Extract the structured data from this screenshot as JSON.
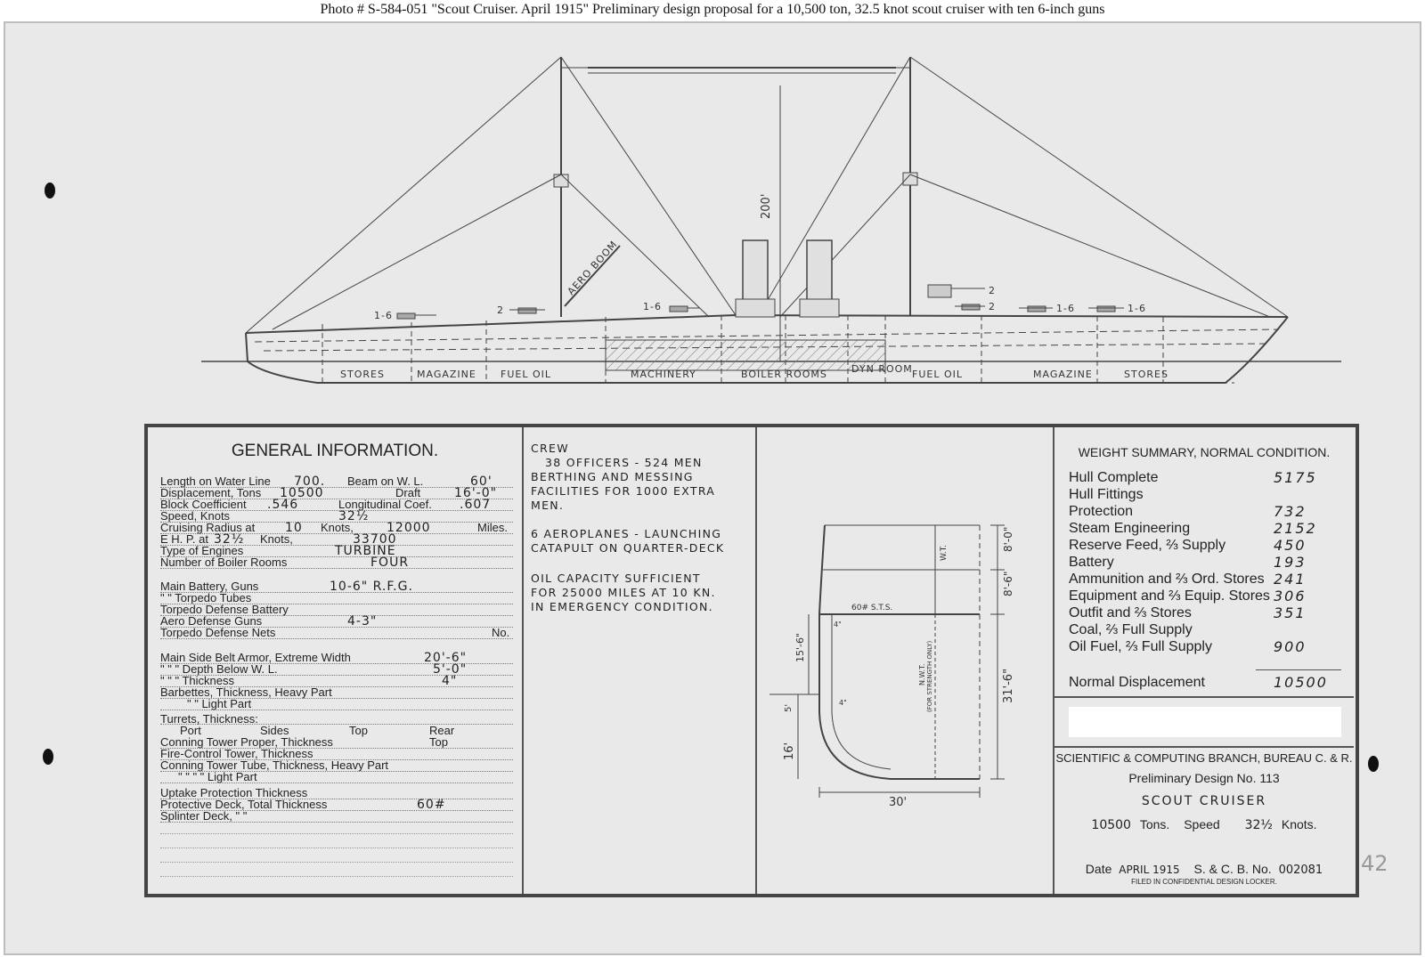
{
  "caption": "Photo #  S-584-051     \"Scout Cruiser.  April 1915\"   Preliminary design proposal for a 10,500 ton, 32.5 knot scout cruiser with ten 6-inch guns",
  "elevation": {
    "mast_height": "200'",
    "aero_boom": "AERO BOOM",
    "gun_labels": [
      "1-6",
      "2",
      "1-6",
      "2",
      "2",
      "1-6",
      "1-6"
    ],
    "compartments": [
      "STORES",
      "MAGAZINE",
      "FUEL OIL",
      "MACHINERY",
      "BOILER ROOMS",
      "DYN ROOM",
      "FUEL OIL",
      "MAGAZINE",
      "STORES"
    ]
  },
  "general": {
    "title": "GENERAL INFORMATION.",
    "rows": [
      {
        "label": "Length on Water Line",
        "value": "700."
      },
      {
        "label": "Beam on W. L.",
        "value": "60'"
      },
      {
        "label": "Displacement, Tons",
        "value": "10500"
      },
      {
        "label": "Draft",
        "value": "16'-0\""
      },
      {
        "label": "Block Coefficient",
        "value": ".546"
      },
      {
        "label": "Longitudinal Coef.",
        "value": ".607"
      },
      {
        "label": "Speed, Knots",
        "value": "32½"
      },
      {
        "label": "Cruising Radius at",
        "value": "10"
      },
      {
        "label": "Knots,",
        "value": "12000"
      },
      {
        "label": "Miles."
      },
      {
        "label": "E H. P. at",
        "value": "32½"
      },
      {
        "label": "Knots,",
        "value": "33700"
      },
      {
        "label": "Type of Engines",
        "value": "TURBINE"
      },
      {
        "label": "Number of Boiler Rooms",
        "value": "FOUR"
      },
      {
        "label": "Main Battery, Guns",
        "value": "10-6\" R.F.G."
      },
      {
        "label": "\"    \"    Torpedo Tubes"
      },
      {
        "label": "Torpedo Defense Battery"
      },
      {
        "label": "Aero Defense Guns",
        "value": "4-3\""
      },
      {
        "label": "Torpedo Defense Nets",
        "value": "No."
      },
      {
        "label": "Main Side Belt Armor, Extreme Width",
        "value": "20'-6\""
      },
      {
        "label": "\"    \"    \"    Depth Below W. L.",
        "value": "5'-0\""
      },
      {
        "label": "\"    \"    \"    Thickness",
        "value": "4\""
      },
      {
        "label": "Barbettes, Thickness, Heavy Part"
      },
      {
        "label": "\"    \"    Light Part"
      },
      {
        "label": "Turrets, Thickness:"
      },
      {
        "label": "Port"
      },
      {
        "label": "Sides"
      },
      {
        "label": "Top"
      },
      {
        "label": "Rear"
      },
      {
        "label": "Conning Tower Proper, Thickness"
      },
      {
        "label": "Top"
      },
      {
        "label": "Fire-Control Tower, Thickness"
      },
      {
        "label": "Conning Tower Tube, Thickness, Heavy Part"
      },
      {
        "label": "\"    \"    \"    \"    Light Part"
      },
      {
        "label": "Uptake Protection Thickness"
      },
      {
        "label": "Protective Deck, Total Thickness",
        "value": "60#"
      },
      {
        "label": "Splinter Deck,    \"    \""
      }
    ]
  },
  "crew": {
    "lines": [
      "CREW",
      "38 OFFICERS - 524 MEN",
      "BERTHING AND MESSING",
      "FACILITIES FOR 1000 EXTRA",
      "MEN.",
      "6 AEROPLANES - LAUNCHING",
      "CATAPULT ON QUARTER-DECK",
      "OIL CAPACITY SUFFICIENT",
      "FOR 25000 MILES AT 10 KN.",
      "IN EMERGENCY CONDITION."
    ]
  },
  "section": {
    "dims": [
      "8'-0\"",
      "8'-6\"",
      "31'-6\"",
      "15'-6\"",
      "5'",
      "16'",
      "30'",
      "4\"",
      "4\""
    ],
    "labels": [
      "W.T.",
      "60# S.T.S.",
      "N.W.T.",
      "(FOR STRENGTH ONLY)"
    ]
  },
  "weights": {
    "title": "WEIGHT SUMMARY, NORMAL CONDITION.",
    "rows": [
      {
        "label": "Hull Complete",
        "value": "5175"
      },
      {
        "label": "Hull Fittings",
        "value": ""
      },
      {
        "label": "Protection",
        "value": "732"
      },
      {
        "label": "Steam Engineering",
        "value": "2152"
      },
      {
        "label": "Reserve Feed, ⅔ Supply",
        "value": "450"
      },
      {
        "label": "Battery",
        "value": "193"
      },
      {
        "label": "Ammunition and ⅔ Ord. Stores",
        "value": "241"
      },
      {
        "label": "Equipment and ⅔ Equip. Stores",
        "value": "306"
      },
      {
        "label": "Outfit and ⅔ Stores",
        "value": "351"
      },
      {
        "label": "Coal, ⅔ Full Supply",
        "value": ""
      },
      {
        "label": "Oil Fuel, ⅔ Full Supply",
        "value": "900"
      }
    ],
    "total_label": "Normal Displacement",
    "total_value": "10500"
  },
  "title_block": {
    "branch": "SCIENTIFIC & COMPUTING BRANCH, BUREAU C. & R.",
    "design": "Preliminary Design No. 113",
    "name": "SCOUT CRUISER",
    "tons_value": "10500",
    "tons_label": "Tons.",
    "speed_label": "Speed",
    "speed_value": "32½",
    "knots_label": "Knots.",
    "date_label": "Date",
    "date_value": "APRIL 1915",
    "scb_label": "S. & C. B. No.",
    "scb_value": "002081",
    "filed": "FILED IN CONFIDENTIAL DESIGN LOCKER."
  },
  "margin_note": "42"
}
